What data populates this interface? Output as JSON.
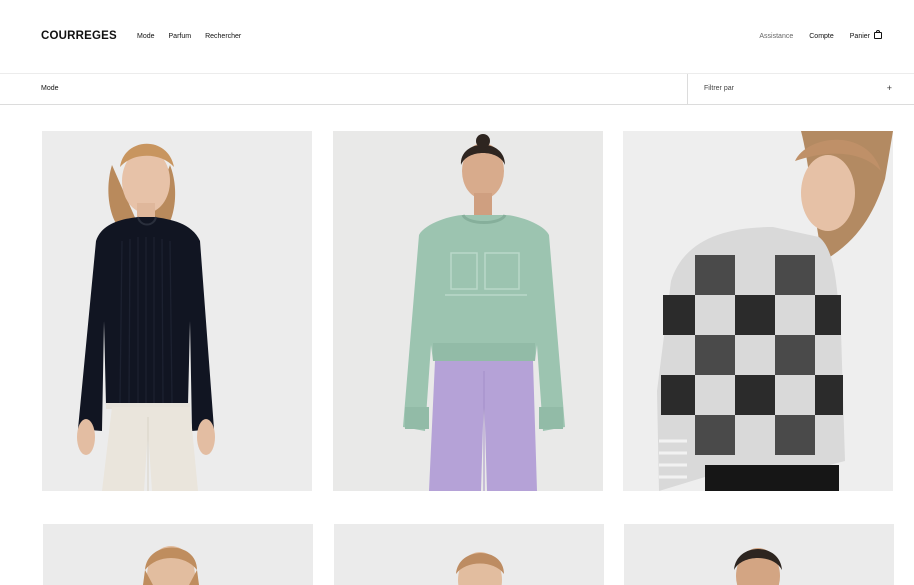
{
  "header": {
    "logo": "COURREGES",
    "nav": [
      "Mode",
      "Parfum",
      "Rechercher"
    ],
    "right": {
      "assistance": "Assistance",
      "account": "Compte",
      "cart": "Panier"
    }
  },
  "filter_bar": {
    "breadcrumb": "Mode",
    "filter_label": "Filtrer par",
    "toggle": "+"
  },
  "products": [
    {
      "name": "black ribbed knit sweater"
    },
    {
      "name": "mint green cropped sweatshirt"
    },
    {
      "name": "black and white check mohair sweater"
    },
    {
      "name": ""
    },
    {
      "name": ""
    },
    {
      "name": ""
    }
  ]
}
